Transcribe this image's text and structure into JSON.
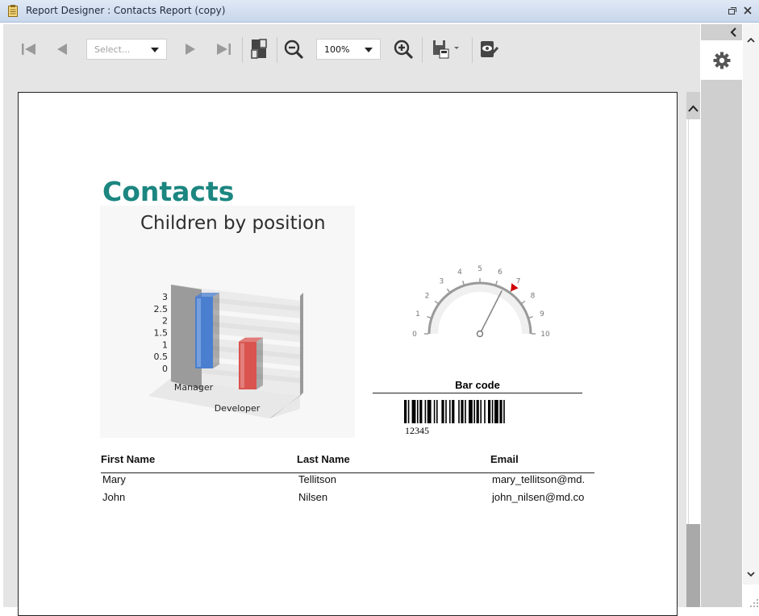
{
  "window": {
    "title": "Report Designer : Contacts Report (copy)"
  },
  "toolbar": {
    "page_select_placeholder": "Select...",
    "zoom_value": "100%",
    "icons": [
      "first-page-icon",
      "prev-page-icon",
      "next-page-icon",
      "last-page-icon",
      "single-page-icon",
      "zoom-out-icon",
      "zoom-in-icon",
      "save-icon",
      "edit-report-icon"
    ]
  },
  "side_panel": {
    "icons": [
      "collapse-chevron-icon",
      "settings-gear-icon"
    ]
  },
  "report": {
    "title": "Contacts",
    "title_color": "#1c8680",
    "chart_title": "Children by position",
    "gauge": {
      "min": 0,
      "max": 10,
      "ticks": [
        "0",
        "1",
        "2",
        "3",
        "4",
        "5",
        "6",
        "7",
        "8",
        "9",
        "10"
      ],
      "needle_value": 6.5,
      "marker_value": 7,
      "marker_color": "#d00000"
    },
    "barcode": {
      "label": "Bar code",
      "value": "12345"
    },
    "table": {
      "headers": [
        "First Name",
        "Last Name",
        "Email"
      ],
      "rows": [
        [
          "Mary",
          "Tellitson",
          "mary_tellitson@md."
        ],
        [
          "John",
          "Nilsen",
          "john_nilsen@md.co"
        ]
      ]
    }
  },
  "chart_data": {
    "type": "bar",
    "title": "Children by position",
    "categories": [
      "Manager",
      "Developer"
    ],
    "values": [
      3,
      2
    ],
    "series_colors": [
      "#4a7fd0",
      "#d9534f"
    ],
    "y_ticks": [
      "3",
      "2.5",
      "2",
      "1.5",
      "1",
      "0.5",
      "0"
    ],
    "ylim": [
      0,
      3
    ],
    "three_d": true,
    "grid": true
  }
}
